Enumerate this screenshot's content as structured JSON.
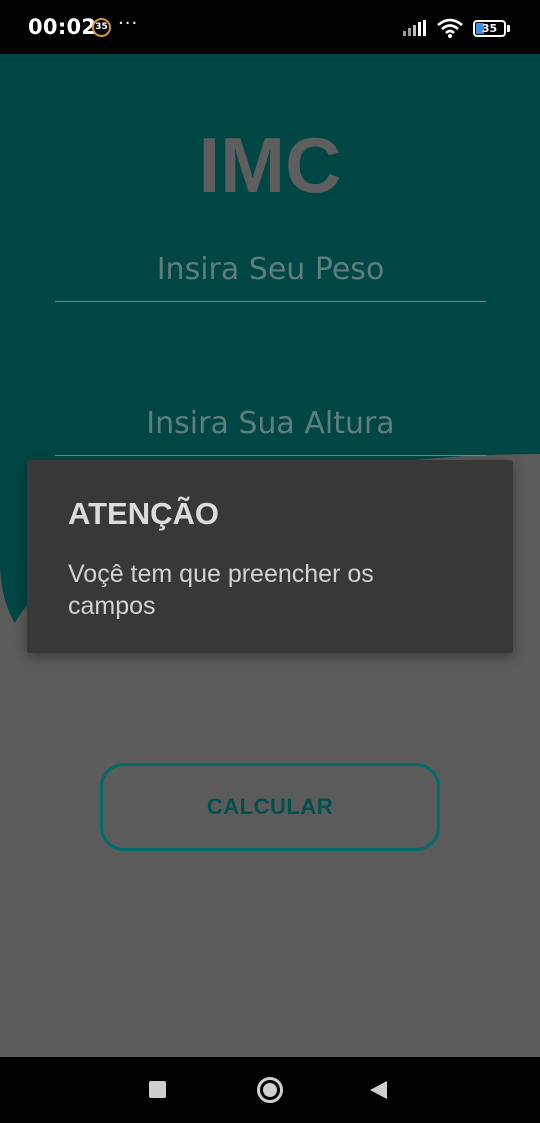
{
  "status_bar": {
    "time": "00:02",
    "notification_badge": "35",
    "more_dots": "···",
    "battery_level": "35",
    "icons": [
      "signal-icon",
      "wifi-icon",
      "battery-icon"
    ]
  },
  "app": {
    "title": "IMC",
    "weight_field": {
      "value": "",
      "placeholder": "Insira Seu Peso"
    },
    "height_field": {
      "value": "",
      "placeholder": "Insira Sua Altura"
    },
    "calculate_button": "CALCULAR",
    "colors": {
      "teal_header": "#004644",
      "button_border": "#006d6a",
      "dialog_bg": "#383838"
    }
  },
  "dialog": {
    "title": "ATENÇÃO",
    "message": "Voçê tem que preencher os campos"
  },
  "nav_bar": {
    "icons": [
      "recent-apps-icon",
      "home-icon",
      "back-icon"
    ]
  }
}
